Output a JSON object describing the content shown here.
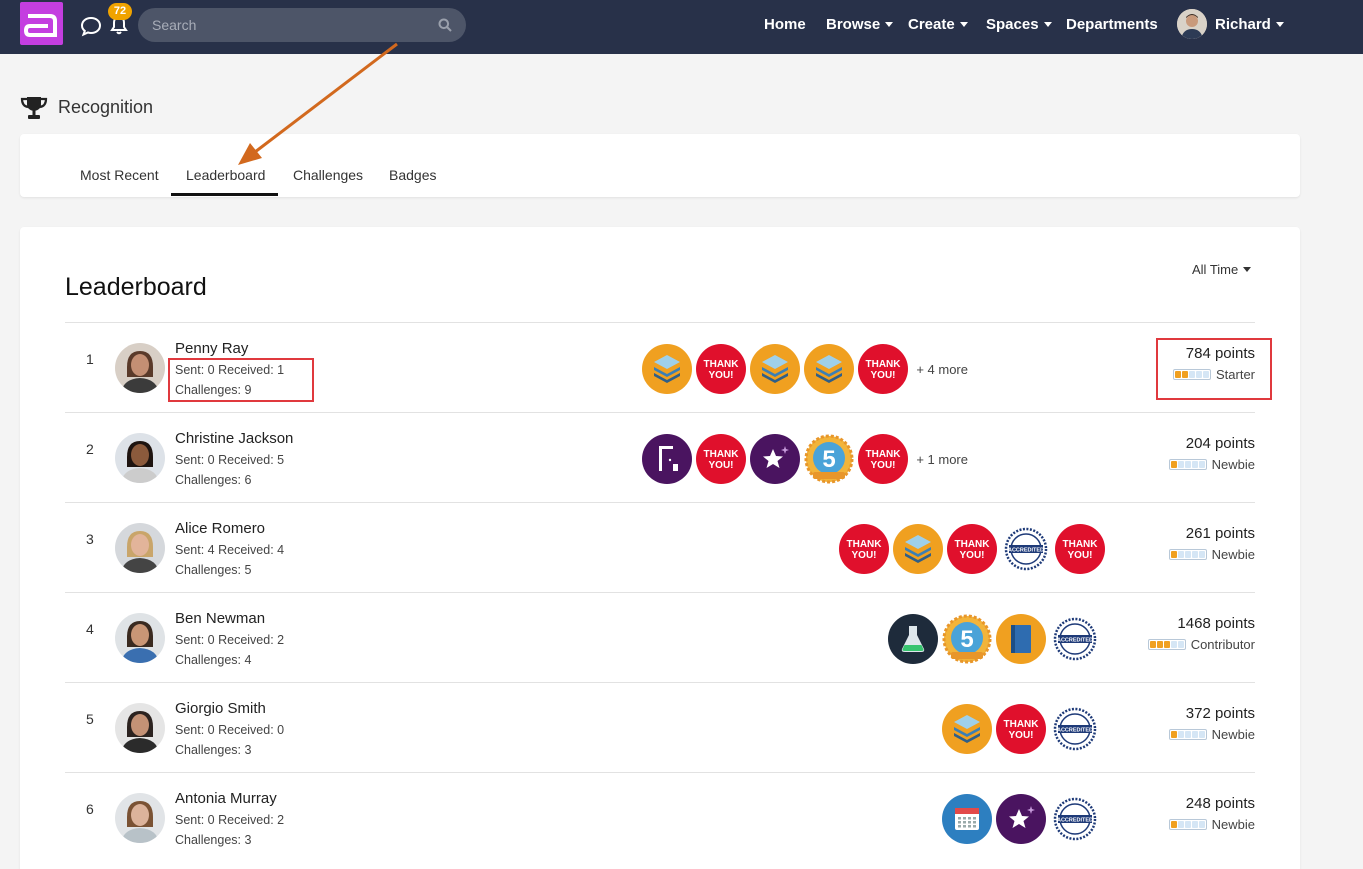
{
  "topbar": {
    "notification_count": "72",
    "search_placeholder": "Search",
    "nav": [
      "Home",
      "Browse",
      "Create",
      "Spaces",
      "Departments"
    ],
    "user_name": "Richard"
  },
  "page": {
    "title": "Recognition"
  },
  "tabs": [
    "Most Recent",
    "Leaderboard",
    "Challenges",
    "Badges"
  ],
  "active_tab": "Leaderboard",
  "leaderboard": {
    "title": "Leaderboard",
    "filter": "All Time",
    "rows": [
      {
        "rank": "1",
        "name": "Penny Ray",
        "sent_received": "Sent: 0 Received: 1",
        "challenges": "Challenges: 9",
        "badges": [
          "layers-badge",
          "thank-you-badge",
          "layers-badge",
          "layers-badge",
          "thank-you-badge"
        ],
        "more": "+ 4 more",
        "points": "784 points",
        "level": "Starter",
        "level_filled": 2
      },
      {
        "rank": "2",
        "name": "Christine Jackson",
        "sent_received": "Sent: 0 Received: 5",
        "challenges": "Challenges: 6",
        "badges": [
          "door-badge",
          "thank-you-badge",
          "star-badge",
          "anniversary-5-badge",
          "thank-you-badge"
        ],
        "more": "+ 1 more",
        "points": "204 points",
        "level": "Newbie",
        "level_filled": 1
      },
      {
        "rank": "3",
        "name": "Alice Romero",
        "sent_received": "Sent: 4 Received: 4",
        "challenges": "Challenges: 5",
        "badges": [
          "thank-you-badge",
          "layers-badge",
          "thank-you-badge",
          "accredited-badge",
          "thank-you-badge"
        ],
        "more": "",
        "points": "261 points",
        "level": "Newbie",
        "level_filled": 1
      },
      {
        "rank": "4",
        "name": "Ben Newman",
        "sent_received": "Sent: 0 Received: 2",
        "challenges": "Challenges: 4",
        "badges": [
          "flask-badge",
          "anniversary-5-badge",
          "book-badge",
          "accredited-badge"
        ],
        "more": "",
        "points": "1468 points",
        "level": "Contributor",
        "level_filled": 3
      },
      {
        "rank": "5",
        "name": "Giorgio Smith",
        "sent_received": "Sent: 0 Received: 0",
        "challenges": "Challenges: 3",
        "badges": [
          "layers-badge",
          "thank-you-badge",
          "accredited-badge"
        ],
        "more": "",
        "points": "372 points",
        "level": "Newbie",
        "level_filled": 1
      },
      {
        "rank": "6",
        "name": "Antonia Murray",
        "sent_received": "Sent: 0 Received: 2",
        "challenges": "Challenges: 3",
        "badges": [
          "calendar-badge",
          "star-badge",
          "accredited-badge"
        ],
        "more": "",
        "points": "248 points",
        "level": "Newbie",
        "level_filled": 1
      }
    ]
  },
  "badge_texts": {
    "thank_you": [
      "THANK",
      "YOU!"
    ],
    "accredited": "ACCREDITED",
    "anniversary": "5"
  },
  "colors": {
    "nav_bg": "#283149",
    "logo": "#c43ee0",
    "badge_orange": "#f0a020",
    "thank_red": "#e0102c",
    "purple": "#4a1460",
    "highlight": "#e0393e",
    "arrow": "#d2691e"
  }
}
